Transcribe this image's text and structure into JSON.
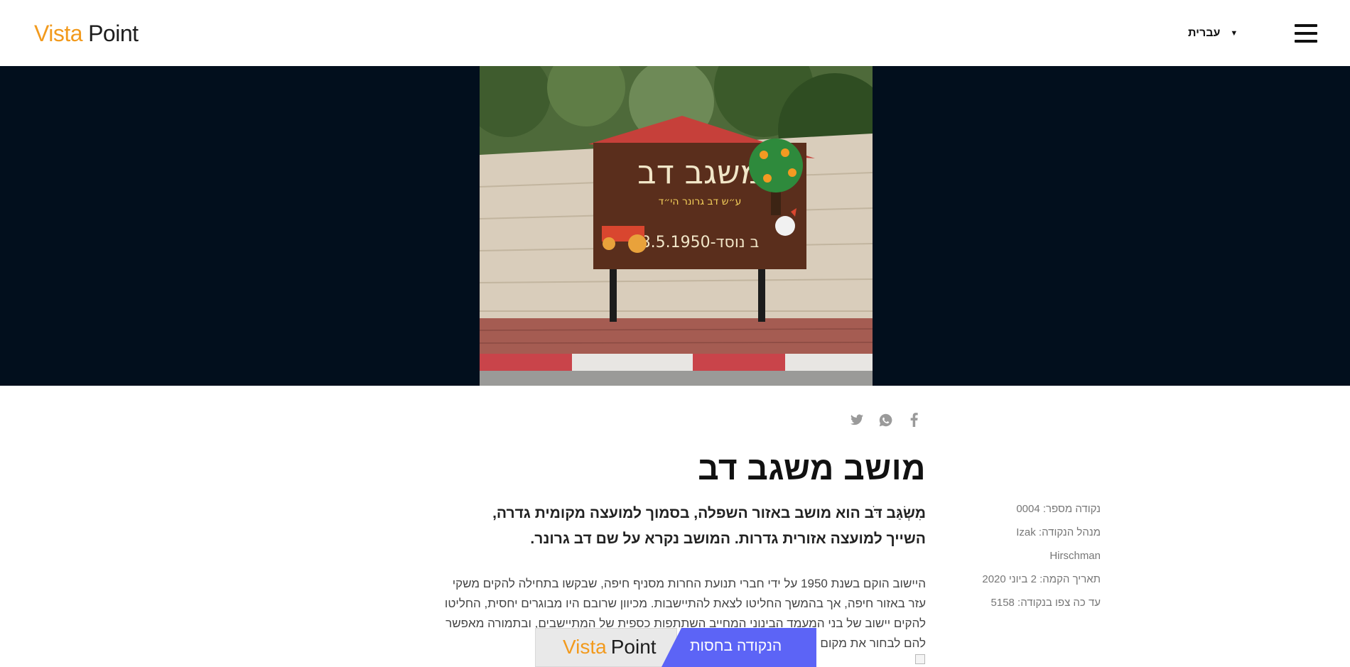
{
  "header": {
    "logo_word_1": "Vista",
    "logo_word_2": "Point",
    "language_label": "עברית",
    "language_caret": "▼"
  },
  "colors": {
    "brand_orange": "#f29a1d",
    "hero_background": "#020f1d",
    "promo_accent": "#5c64f6",
    "muted_text": "#777777"
  },
  "share": {
    "icons": [
      "facebook-icon",
      "whatsapp-icon",
      "twitter-icon"
    ]
  },
  "article": {
    "title": "מושב משגב דב",
    "lead": "מִשְׂגַּב דֹּב הוא מושב באזור השפלה, בסמוך למועצה מקומית גדרה, השייך למועצה אזורית גדרות. המושב נקרא על שם דב גרונר.",
    "body": "היישוב הוקם בשנת 1950 על ידי חברי תנועת החרות מסניף חיפה, שבקשו בתחילה להקים משקי עזר באזור חיפה, אך בהמשך החליטו לצאת להתיישבות. מכיוון שרובם היו מבוגרים יחסית, החליטו להקים יישוב של בני המעמד הבינוני המחייב השתתפות כספית של המתיישבים, ובתמורה מאפשר להם לבחור את מקום משקו."
  },
  "meta": {
    "point_number": "נקודה מספר: 0004",
    "manager": "מנהל הנקודה: Izak Hirschman",
    "established": "תאריך הקמה: 2 ביוני 2020",
    "views": "עד כה צפו בנקודה: 5158"
  },
  "promo": {
    "label": "הנקודה בחסות",
    "logo_word_1": "Vista",
    "logo_word_2": "Point"
  }
}
